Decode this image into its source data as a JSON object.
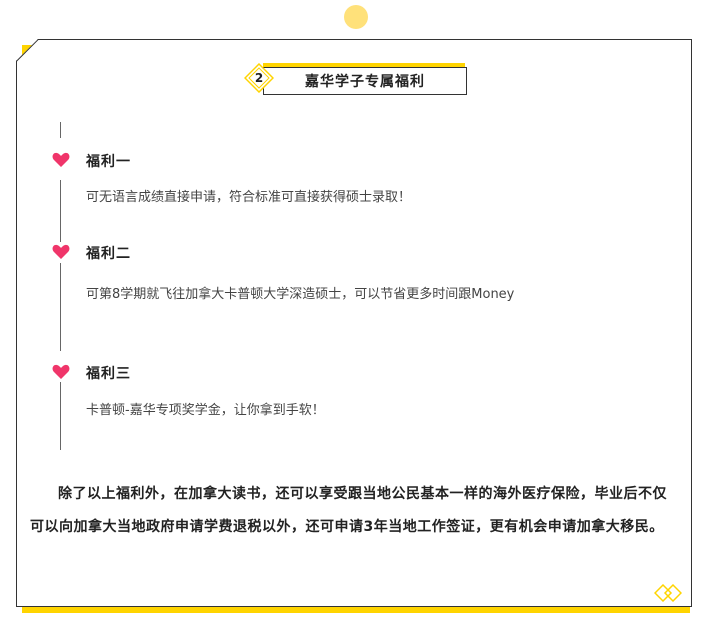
{
  "header": {
    "number": "2",
    "title": "嘉华学子专属福利"
  },
  "benefits": [
    {
      "title": "福利一",
      "desc": "可无语言成绩直接申请，符合标准可直接获得硕士录取！"
    },
    {
      "title": "福利二",
      "desc": "可第8学期就飞往加拿大卡普顿大学深造硕士，可以节省更多时间跟Money"
    },
    {
      "title": "福利三",
      "desc": "卡普顿-嘉华专项奖学金，让你拿到手软！"
    }
  ],
  "paragraph": "除了以上福利外，在加拿大读书，还可以享受跟当地公民基本一样的海外医疗保险，毕业后不仅可以向加拿大当地政府申请学费退税以外，还可申请3年当地工作签证，更有机会申请加拿大移民。",
  "colors": {
    "accent": "#ffd400",
    "heart": "#f0356a",
    "border": "#333333"
  },
  "icons": {
    "marker": "heart-icon",
    "badge": "diamond-icon",
    "end": "double-diamond-icon"
  }
}
